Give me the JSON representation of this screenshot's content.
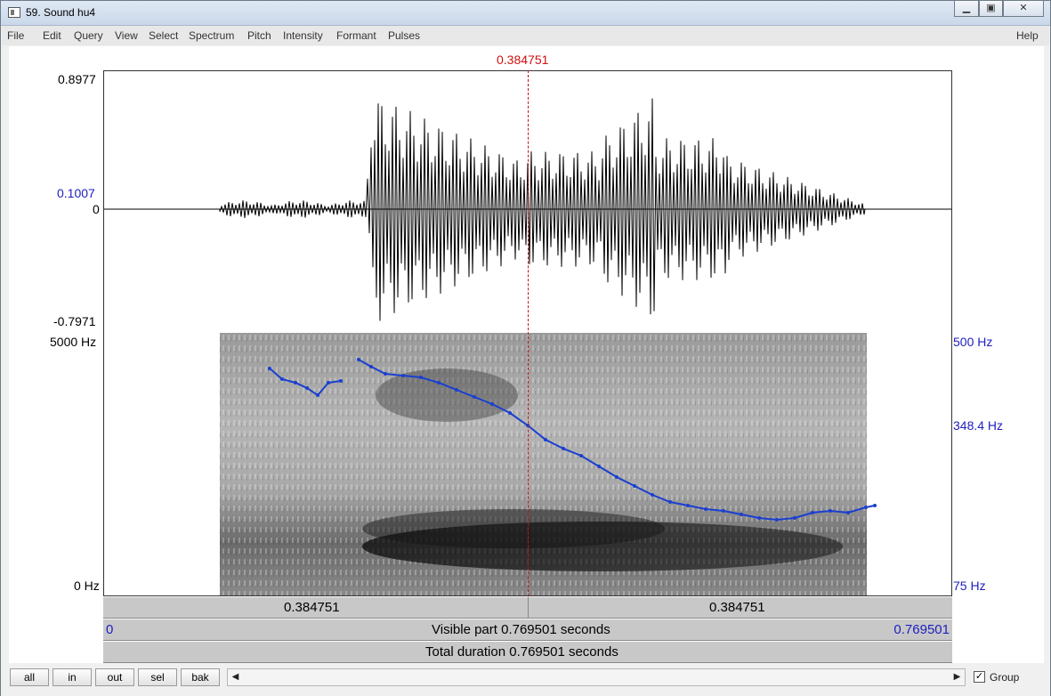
{
  "window": {
    "title": "59. Sound hu4"
  },
  "menu": [
    "File",
    "Edit",
    "Query",
    "View",
    "Select",
    "Spectrum",
    "Pitch",
    "Intensity",
    "Formant",
    "Pulses"
  ],
  "help_label": "Help",
  "cursor": {
    "time_label": "0.384751",
    "left_label": "0.384751",
    "right_label": "0.384751"
  },
  "waveform": {
    "max_label": "0.8977",
    "cursor_value_label": "0.1007",
    "zero_label": "0",
    "min_label": "-0.7971"
  },
  "spectrogram": {
    "top_label": "5000 Hz",
    "bottom_label": "0 Hz"
  },
  "pitch": {
    "top_label": "500 Hz",
    "mid_label": "348.4 Hz",
    "bottom_label": "75 Hz"
  },
  "visible": {
    "start_label": "0",
    "text": "Visible part 0.769501 seconds",
    "end_label": "0.769501"
  },
  "total": {
    "text": "Total duration 0.769501 seconds"
  },
  "buttons": {
    "all": "all",
    "in": "in",
    "out": "out",
    "sel": "sel",
    "bak": "bak"
  },
  "group": {
    "label": "Group",
    "checked": true
  },
  "colors": {
    "cursor": "#d01010",
    "pitch": "#1a3fd0",
    "axis_blue": "#2020c0"
  }
}
